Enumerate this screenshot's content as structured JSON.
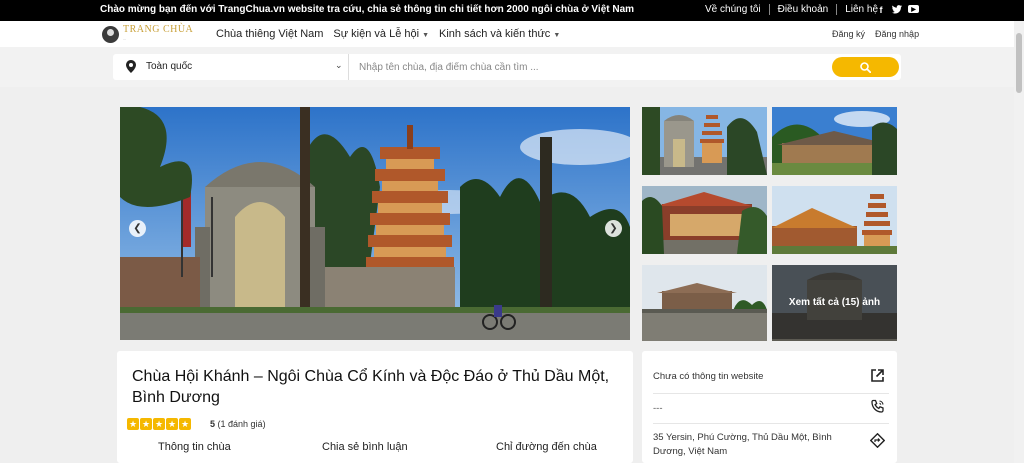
{
  "topbar": {
    "welcome": "Chào mừng bạn đến với TrangChua.vn website tra cứu, chia sẻ thông tin chi tiết hơn 2000 ngôi chùa ở Việt Nam",
    "links": [
      "Về chúng tôi",
      "Điều khoản",
      "Liên hệ"
    ],
    "social": {
      "facebook": "f",
      "twitter": "t",
      "youtube": "▶"
    }
  },
  "nav": {
    "logo": {
      "brand": "TRANG CHÙA",
      "tagline": "...",
      "icon": "logo-icon"
    },
    "menu": [
      "Chùa thiêng Việt Nam",
      "Sự kiện và Lễ hội",
      "Kinh sách và kiến thức"
    ],
    "auth": {
      "register": "Đăng ký",
      "login": "Đăng nhập"
    }
  },
  "search": {
    "location": "Toàn quốc",
    "placeholder": "Nhập tên chùa, địa điểm chùa cần tìm ...",
    "query": ""
  },
  "gallery": {
    "view_all": "Xem tất cả (15) ảnh"
  },
  "temple": {
    "title": "Chùa Hội Khánh – Ngôi Chùa Cổ Kính và Độc Đáo ở Thủ Dầu Một, Bình Dương",
    "stars": 5,
    "rating_value": "5",
    "rating_count": "(1 đánh giá)",
    "tabs": [
      "Thông tin chùa",
      "Chia sẻ bình luận",
      "Chỉ đường đến chùa"
    ]
  },
  "info": {
    "website": "Chưa có thông tin website",
    "phone": "---",
    "address": "35 Yersin, Phú Cường, Thủ Dầu Một, Bình Dương, Việt Nam"
  },
  "colors": {
    "accent": "#f5b800",
    "topbar": "#000000",
    "brand_gold": "#c9a13a"
  }
}
